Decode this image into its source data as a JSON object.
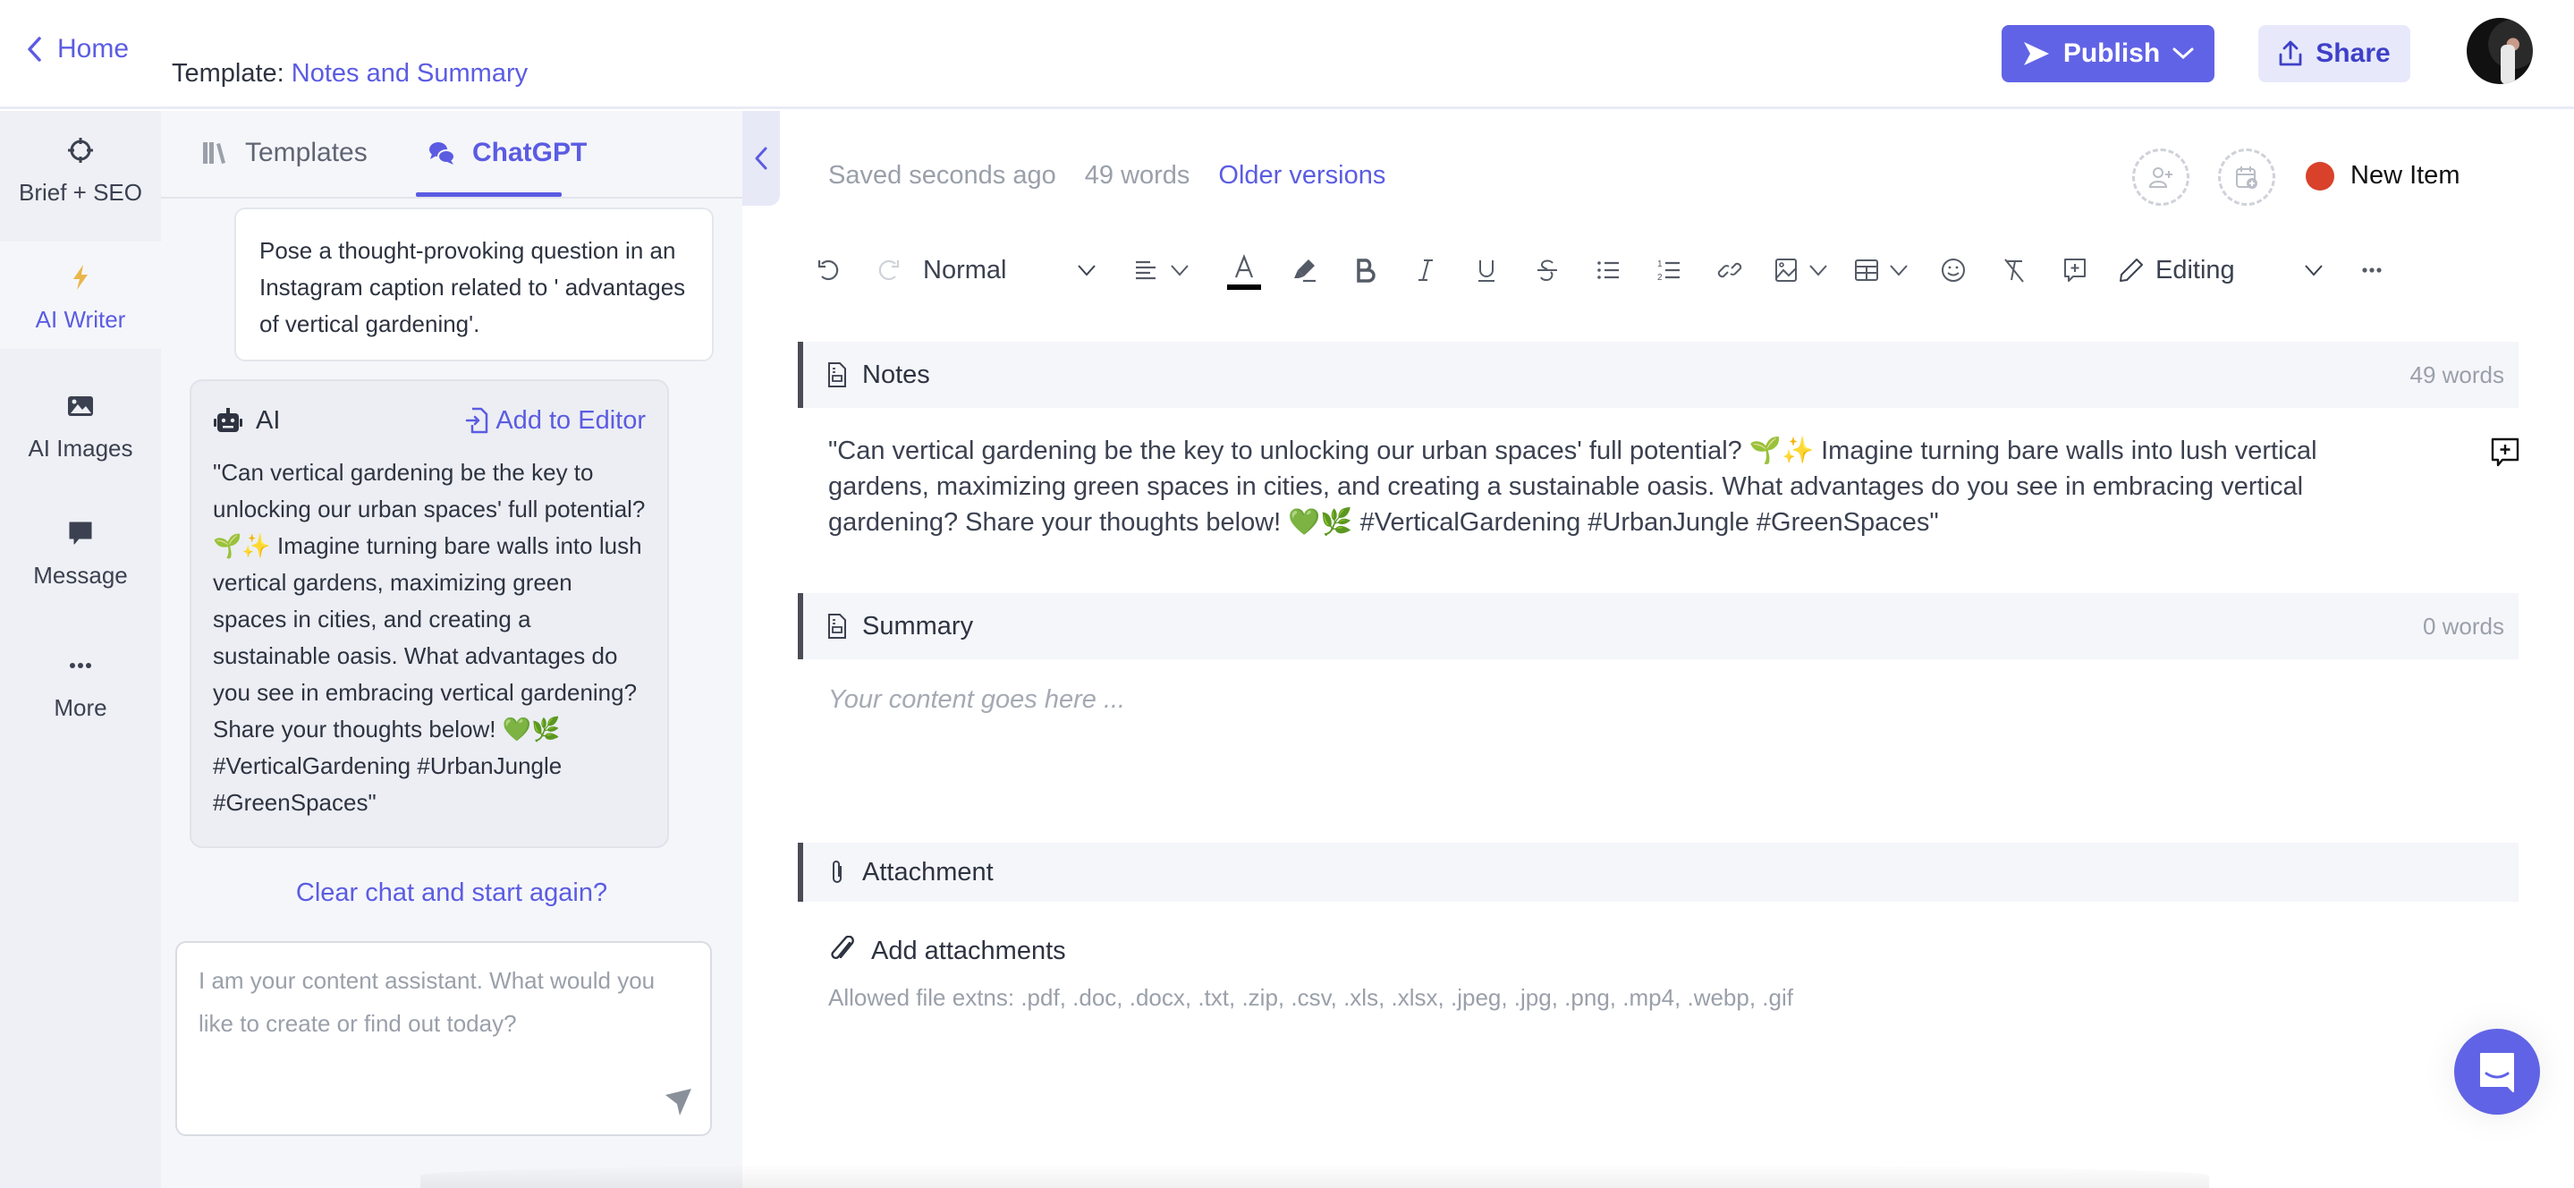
{
  "header": {
    "home_label": "Home",
    "template_prefix": "Template:",
    "template_name": "Notes and Summary",
    "publish_label": "Publish",
    "share_label": "Share"
  },
  "rail": {
    "items": [
      {
        "label": "Brief + SEO",
        "icon": "crosshair-icon"
      },
      {
        "label": "AI Writer",
        "icon": "lightning-icon",
        "active": true
      },
      {
        "label": "AI Images",
        "icon": "image-icon"
      },
      {
        "label": "Message",
        "icon": "message-icon"
      },
      {
        "label": "More",
        "icon": "more-icon"
      }
    ]
  },
  "chat": {
    "tabs": [
      {
        "label": "Templates",
        "icon": "library-icon"
      },
      {
        "label": "ChatGPT",
        "icon": "chat-bubbles-icon",
        "active": true
      }
    ],
    "prompt": "Pose a thought-provoking question in an Instagram caption related to ' advantages of vertical gardening'.",
    "response_label": "AI",
    "add_to_editor_label": "Add to Editor",
    "response_text": "\"Can vertical gardening be the key to unlocking our urban spaces' full potential? 🌱✨ Imagine turning bare walls into lush vertical gardens, maximizing green spaces in cities, and creating a sustainable oasis. What advantages do you see in embracing vertical gardening? Share your thoughts below! 💚🌿 #VerticalGardening #UrbanJungle #GreenSpaces\"",
    "clear_chat_label": "Clear chat and start again?",
    "input_value": "",
    "input_placeholder": "I am your content assistant. What would you like to create or find out today?"
  },
  "editor": {
    "saved_status": "Saved seconds ago",
    "word_count": "49 words",
    "older_versions_label": "Older versions",
    "item_status": "New Item",
    "status_color": "#d9412a",
    "toolbar": {
      "style_value": "Normal",
      "mode_value": "Editing"
    },
    "sections": [
      {
        "title": "Notes",
        "count": "49 words",
        "body": "\"Can vertical gardening be the key to unlocking our urban spaces' full potential? 🌱✨ Imagine turning bare walls into lush vertical gardens, maximizing green spaces in cities, and creating a sustainable oasis. What advantages do you see in embracing vertical gardening? Share your thoughts below! 💚🌿 #VerticalGardening #UrbanJungle #GreenSpaces\""
      },
      {
        "title": "Summary",
        "count": "0 words",
        "placeholder": "Your content goes here ..."
      },
      {
        "title": "Attachment",
        "add_label": "Add attachments",
        "allowed_text": "Allowed file extns: .pdf, .doc, .docx, .txt, .zip, .csv, .xls, .xlsx, .jpeg, .jpg, .png, .mp4, .webp, .gif"
      }
    ]
  },
  "colors": {
    "accent": "#5b5ce2",
    "publish_bg": "#6163e6",
    "share_bg": "#e7e9fb"
  }
}
